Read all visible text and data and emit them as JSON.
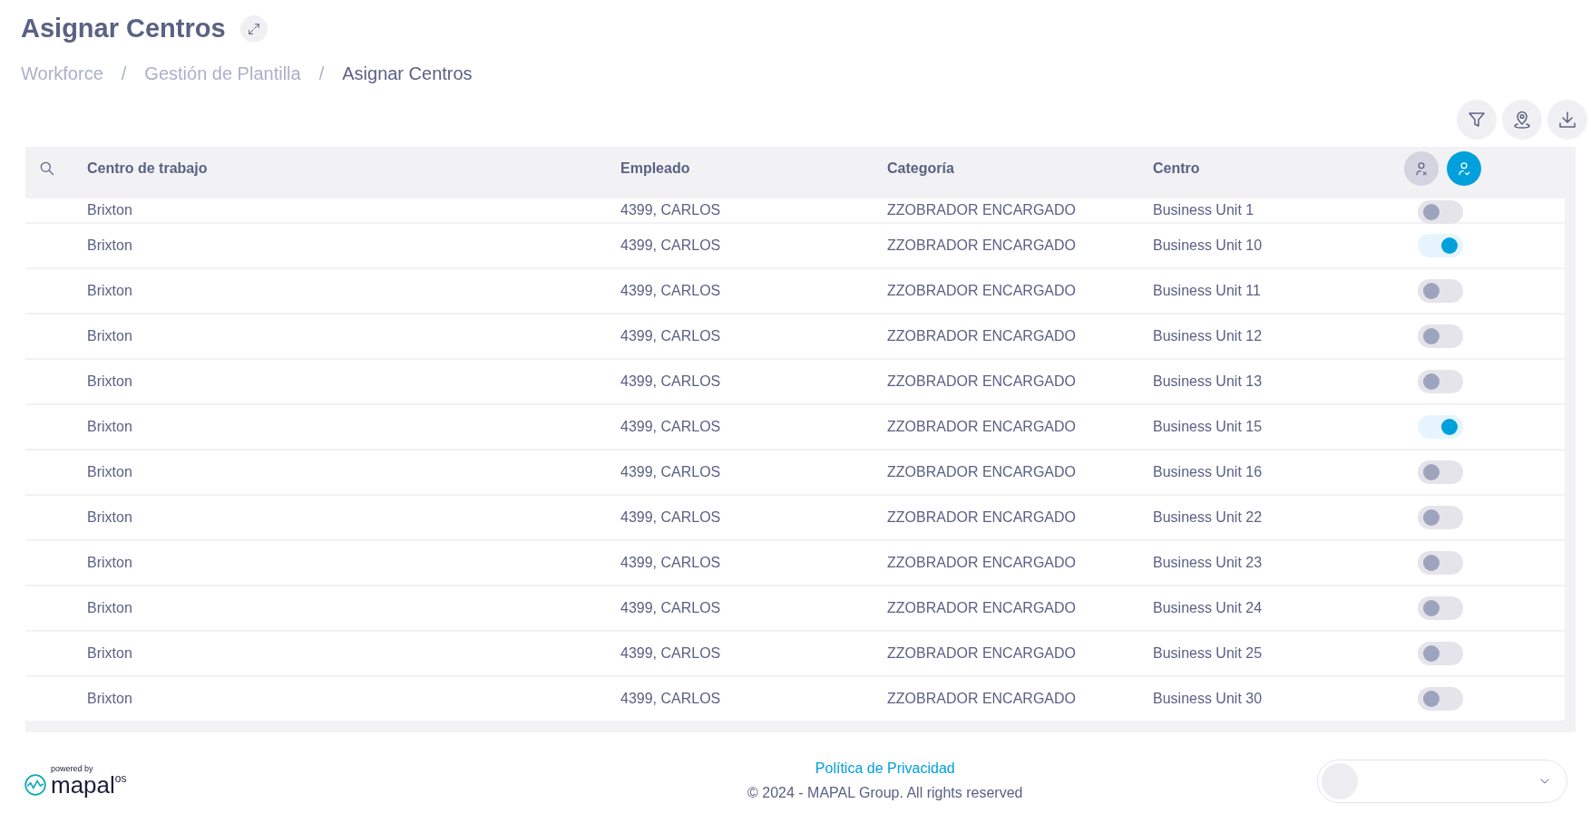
{
  "header": {
    "title": "Asignar Centros",
    "breadcrumb": [
      {
        "label": "Workforce",
        "current": false
      },
      {
        "label": "Gestión de Plantilla",
        "current": false
      },
      {
        "label": "Asignar Centros",
        "current": true
      }
    ],
    "separator": "/"
  },
  "table": {
    "columns": [
      "Centro de trabajo",
      "Empleado",
      "Categoría",
      "Centro"
    ],
    "header_buttons": [
      {
        "kind": "unassign",
        "selected": false
      },
      {
        "kind": "assign",
        "selected": true
      }
    ],
    "rows": [
      {
        "centro_trabajo": "Brixton",
        "empleado": "4399, CARLOS",
        "categoria": "ZZOBRADOR ENCARGADO",
        "centro": "Business Unit 1",
        "on": false
      },
      {
        "centro_trabajo": "Brixton",
        "empleado": "4399, CARLOS",
        "categoria": "ZZOBRADOR ENCARGADO",
        "centro": "Business Unit 10",
        "on": true
      },
      {
        "centro_trabajo": "Brixton",
        "empleado": "4399, CARLOS",
        "categoria": "ZZOBRADOR ENCARGADO",
        "centro": "Business Unit 11",
        "on": false
      },
      {
        "centro_trabajo": "Brixton",
        "empleado": "4399, CARLOS",
        "categoria": "ZZOBRADOR ENCARGADO",
        "centro": "Business Unit 12",
        "on": false
      },
      {
        "centro_trabajo": "Brixton",
        "empleado": "4399, CARLOS",
        "categoria": "ZZOBRADOR ENCARGADO",
        "centro": "Business Unit 13",
        "on": false
      },
      {
        "centro_trabajo": "Brixton",
        "empleado": "4399, CARLOS",
        "categoria": "ZZOBRADOR ENCARGADO",
        "centro": "Business Unit 15",
        "on": true
      },
      {
        "centro_trabajo": "Brixton",
        "empleado": "4399, CARLOS",
        "categoria": "ZZOBRADOR ENCARGADO",
        "centro": "Business Unit 16",
        "on": false
      },
      {
        "centro_trabajo": "Brixton",
        "empleado": "4399, CARLOS",
        "categoria": "ZZOBRADOR ENCARGADO",
        "centro": "Business Unit 22",
        "on": false
      },
      {
        "centro_trabajo": "Brixton",
        "empleado": "4399, CARLOS",
        "categoria": "ZZOBRADOR ENCARGADO",
        "centro": "Business Unit 23",
        "on": false
      },
      {
        "centro_trabajo": "Brixton",
        "empleado": "4399, CARLOS",
        "categoria": "ZZOBRADOR ENCARGADO",
        "centro": "Business Unit 24",
        "on": false
      },
      {
        "centro_trabajo": "Brixton",
        "empleado": "4399, CARLOS",
        "categoria": "ZZOBRADOR ENCARGADO",
        "centro": "Business Unit 25",
        "on": false
      },
      {
        "centro_trabajo": "Brixton",
        "empleado": "4399, CARLOS",
        "categoria": "ZZOBRADOR ENCARGADO",
        "centro": "Business Unit 30",
        "on": false
      }
    ]
  },
  "footer": {
    "logo_caption": "powered by",
    "logo_word": "mapal",
    "logo_suffix": "os",
    "privacy_link": "Política de Privacidad",
    "copyright": "© 2024 - MAPAL Group. All rights reserved"
  }
}
